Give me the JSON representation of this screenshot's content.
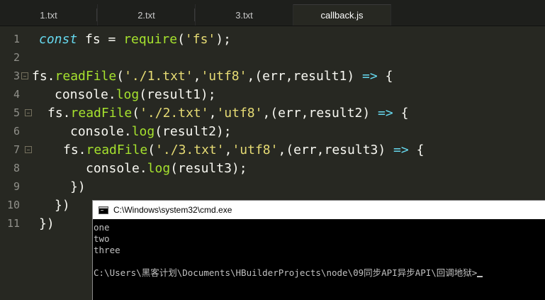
{
  "tabs": [
    {
      "label": "1.txt"
    },
    {
      "label": "2.txt"
    },
    {
      "label": "3.txt"
    },
    {
      "label": "callback.js"
    }
  ],
  "editor": {
    "line_numbers": [
      "1",
      "2",
      "3",
      "4",
      "5",
      "6",
      "7",
      "8",
      "9",
      "10",
      "11"
    ],
    "l1": {
      "kw": "const",
      "a": " fs = ",
      "fn": "require",
      "b": "(",
      "s": "'fs'",
      "c": ");"
    },
    "l3": {
      "obj": "fs.",
      "fn": "readFile",
      "a": "(",
      "s1": "'./1.txt'",
      "c1": ",",
      "s2": "'utf8'",
      "b": ",(err,result1) ",
      "op": "=>",
      "d": " {"
    },
    "l4": {
      "obj": "console.",
      "fn": "log",
      "a": "(result1);"
    },
    "l5": {
      "obj": "fs.",
      "fn": "readFile",
      "a": "(",
      "s1": "'./2.txt'",
      "c1": ",",
      "s2": "'utf8'",
      "b": ",(err,result2) ",
      "op": "=>",
      "d": " {"
    },
    "l6": {
      "obj": "console.",
      "fn": "log",
      "a": "(result2);"
    },
    "l7": {
      "obj": "fs.",
      "fn": "readFile",
      "a": "(",
      "s1": "'./3.txt'",
      "c1": ",",
      "s2": "'utf8'",
      "b": ",(err,result3) ",
      "op": "=>",
      "d": " {"
    },
    "l8": {
      "obj": "console.",
      "fn": "log",
      "a": "(result3);"
    },
    "l9": "})",
    "l10": "})",
    "l11": "})"
  },
  "cmd": {
    "title": "C:\\Windows\\system32\\cmd.exe",
    "output": [
      "one",
      "two",
      "three"
    ],
    "prompt": "C:\\Users\\黑客计划\\Documents\\HBuilderProjects\\node\\09同步API异步API\\回调地狱>"
  }
}
